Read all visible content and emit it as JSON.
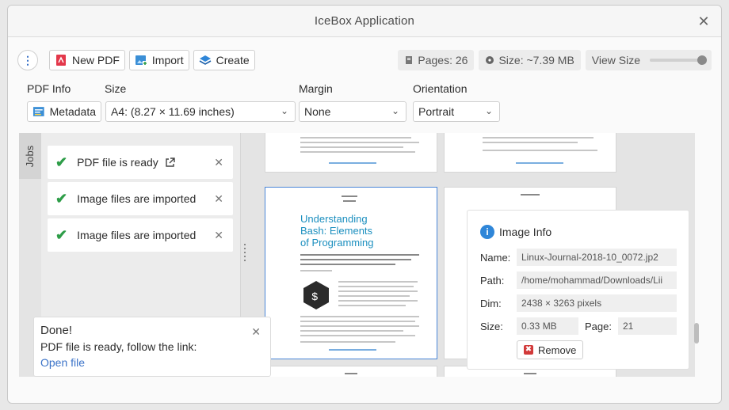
{
  "window": {
    "title": "IceBox Application"
  },
  "toolbar": {
    "menu_label": "⋮",
    "new_pdf": "New PDF",
    "import": "Import",
    "create": "Create",
    "pages": "Pages: 26",
    "size": "Size: ~7.39 MB",
    "view_size": "View Size"
  },
  "options": {
    "pdf_info_label": "PDF Info",
    "metadata_button": "Metadata",
    "size_label": "Size",
    "size_value": "A4: (8.27 × 11.69 inches)",
    "margin_label": "Margin",
    "margin_value": "None",
    "orientation_label": "Orientation",
    "orientation_value": "Portrait"
  },
  "jobs": {
    "tab_label": "Jobs",
    "items": [
      {
        "label": "PDF file is ready"
      },
      {
        "label": "Image files are imported"
      },
      {
        "label": "Image files are imported"
      }
    ]
  },
  "notification": {
    "title": "Done!",
    "text": "PDF file is ready, follow the link:",
    "link": "Open file"
  },
  "page_preview": {
    "article_title_1": "Understanding",
    "article_title_2": "Bash: Elements",
    "article_title_3": "of Programming"
  },
  "image_info": {
    "title": "Image Info",
    "name_label": "Name:",
    "name_value": "Linux-Journal-2018-10_0072.jp2",
    "path_label": "Path:",
    "path_value": "/home/mohammad/Downloads/Lii",
    "dim_label": "Dim:",
    "dim_value": "2438 × 3263 pixels",
    "size_label": "Size:",
    "size_value": "0.33 MB",
    "page_label": "Page:",
    "page_value": "21",
    "remove_label": "Remove"
  }
}
